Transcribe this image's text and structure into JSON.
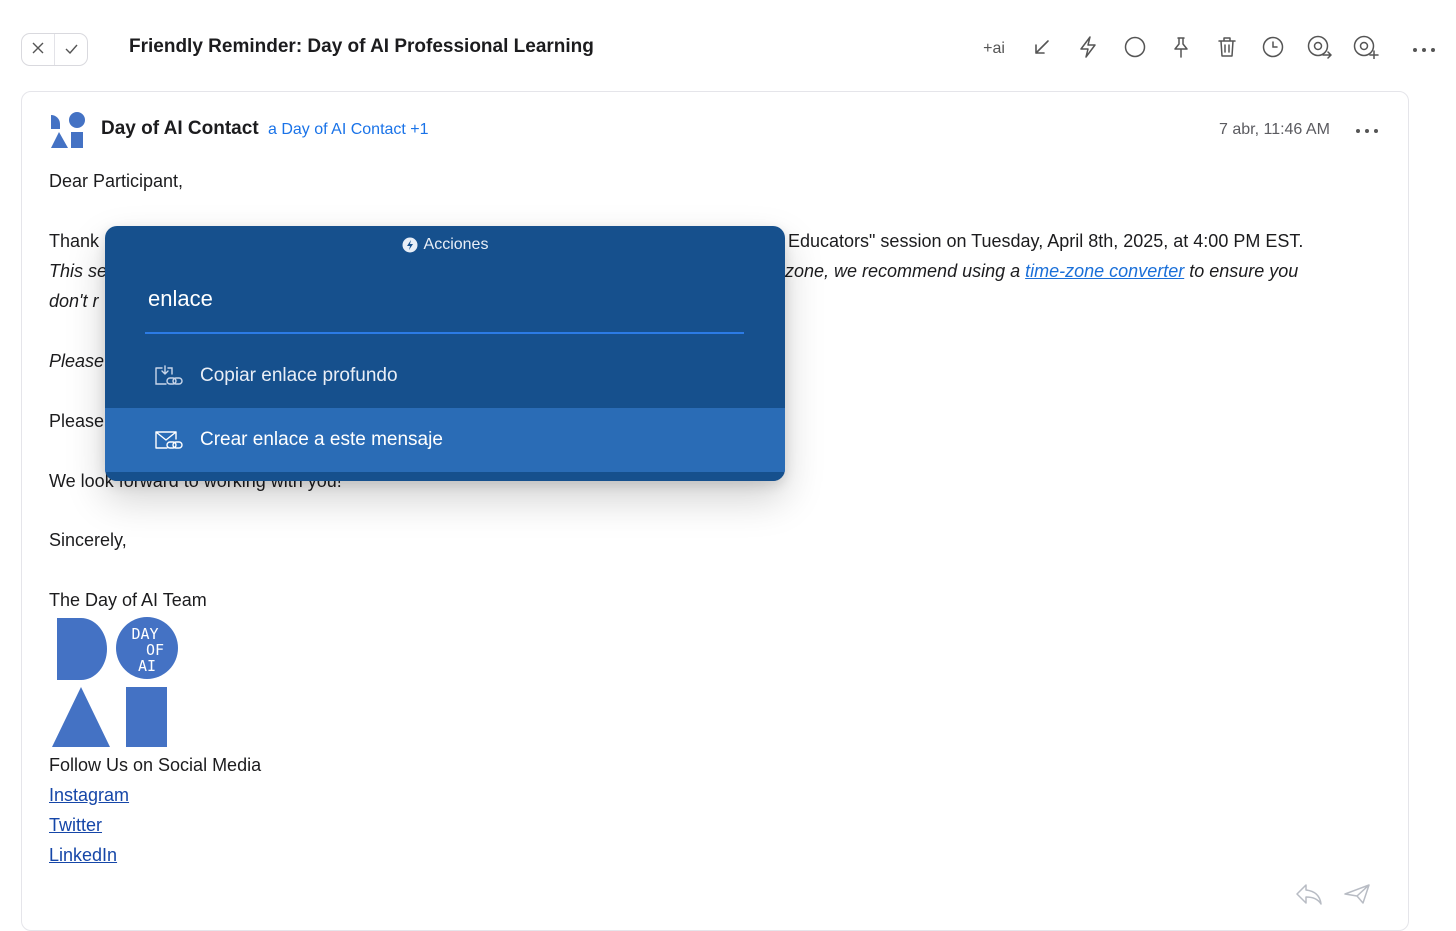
{
  "header": {
    "subject": "Friendly Reminder: Day of AI Professional Learning",
    "ai_label": "+ai",
    "nav": {
      "close_icon": "close-icon",
      "done_icon": "check-icon"
    },
    "toolbar_icons": [
      "arrow-down-left-icon",
      "bolt-icon",
      "circle-icon",
      "pin-icon",
      "trash-icon",
      "clock-icon",
      "forward-at-icon",
      "add-at-icon",
      "more-icon"
    ]
  },
  "message": {
    "sender": "Day of AI Contact",
    "to": "a Day of AI Contact +1",
    "date": "7 abr, 11:46 AM",
    "greeting": "Dear Participant,",
    "para1_start": "Thank",
    "para1_end": "Educators\" session on Tuesday, April 8th, 2025, at 4:00 PM EST.",
    "para2_start": "This se",
    "para2_mid": "zone, we recommend using a ",
    "para2_link": "time-zone converter",
    "para2_end": " to ensure you",
    "para3_start": "don't r",
    "para4_start": "Please",
    "para5_start": "Please",
    "para6": "We look forward to working with you!",
    "closing": "Sincerely,",
    "signature": "The Day of AI Team",
    "logo_text": [
      "DAY",
      "OF",
      "AI"
    ],
    "follow": "Follow Us on Social Media",
    "links": [
      "Instagram",
      "Twitter",
      "LinkedIn"
    ]
  },
  "palette": {
    "title": "Acciones",
    "query": "enlace",
    "items": [
      {
        "label": "Copiar enlace profundo",
        "icon": "copy-link-icon",
        "selected": false
      },
      {
        "label": "Crear enlace a este mensaje",
        "icon": "mail-link-icon",
        "selected": true
      }
    ]
  },
  "colors": {
    "palette_bg": "#16508d",
    "palette_selected": "#2a6cb6",
    "brand_blue": "#4472c4",
    "link_blue": "#1a73e8"
  }
}
